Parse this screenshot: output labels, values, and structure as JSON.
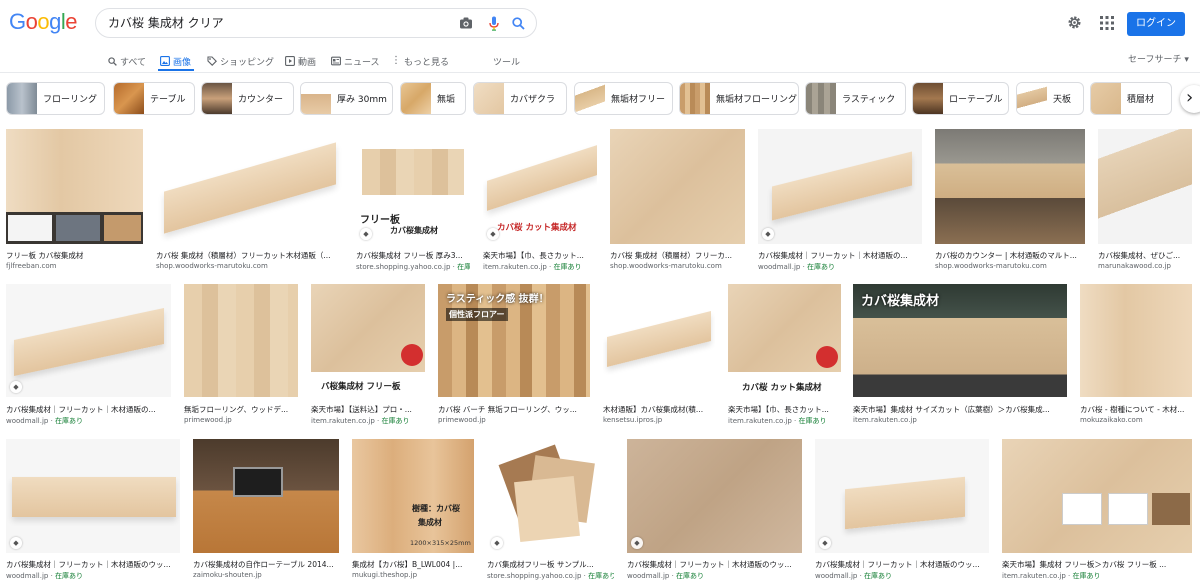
{
  "logo": "Google",
  "search": {
    "query": "カバ桜 集成材 クリア"
  },
  "header": {
    "login_label": "ログイン"
  },
  "nav": {
    "tabs": [
      {
        "label": "すべて",
        "icon": "search-icon"
      },
      {
        "label": "画像",
        "icon": "image-icon"
      },
      {
        "label": "ショッピング",
        "icon": "tag-icon"
      },
      {
        "label": "動画",
        "icon": "video-icon"
      },
      {
        "label": "ニュース",
        "icon": "news-icon"
      },
      {
        "label": "もっと見る",
        "icon": "more-icon"
      },
      {
        "label": "ツール",
        "icon": ""
      }
    ],
    "safe_search": "セーフサーチ ▾"
  },
  "chips": [
    "フローリング",
    "テーブル",
    "カウンター",
    "厚み 30mm",
    "無垢",
    "カバザクラ",
    "無垢材フリー",
    "無垢材フローリング",
    "ラスティック",
    "ローテーブル",
    "天板",
    "積層材"
  ],
  "results": [
    {
      "title": "フリー板 カバ桜集成材",
      "source": "fjlfreeban.com",
      "stock": ""
    },
    {
      "title": "カバ桜 集成材（積層材）フリーカット木材通販（...",
      "source": "shop.woodworks-marutoku.com",
      "stock": ""
    },
    {
      "title": "カバ桜集成材 フリー板 厚み3...",
      "source": "store.shopping.yahoo.co.jp",
      "stock": "在庫あり"
    },
    {
      "title": "楽天市場】【巾、長さカット...",
      "source": "item.rakuten.co.jp",
      "stock": "在庫あり"
    },
    {
      "title": "カバ桜 集成材（積層材）フリーカ...",
      "source": "shop.woodworks-marutoku.com",
      "stock": ""
    },
    {
      "title": "カバ桜集成材｜フリーカット｜木材通販の...",
      "source": "woodmall.jp",
      "stock": "在庫あり"
    },
    {
      "title": "カバ桜のカウンター | 木材通販のマルト...",
      "source": "shop.woodworks-marutoku.com",
      "stock": ""
    },
    {
      "title": "カバ桜集成材、ぜひご...",
      "source": "marunakawood.co.jp",
      "stock": ""
    },
    {
      "title": "カバ桜集成材｜フリーカット｜木材通販の...",
      "source": "woodmall.jp",
      "stock": "在庫あり"
    },
    {
      "title": "無垢フローリング、ウッドデ...",
      "source": "primewood.jp",
      "stock": ""
    },
    {
      "title": "楽天市場】【送料込】プロ・...",
      "source": "item.rakuten.co.jp",
      "stock": "在庫あり"
    },
    {
      "title": "カバ桜 バーチ 無垢フローリング、ウッ...",
      "source": "primewood.jp",
      "stock": ""
    },
    {
      "title": "木材通販】カバ桜集成材(積...",
      "source": "kensetsu.ipros.jp",
      "stock": ""
    },
    {
      "title": "楽天市場】【巾、長さカット...",
      "source": "item.rakuten.co.jp",
      "stock": "在庫あり"
    },
    {
      "title": "楽天市場】集成材 サイズカット（広葉樹）＞カバ桜集成...",
      "source": "item.rakuten.co.jp",
      "stock": ""
    },
    {
      "title": "カバ桜 - 樹種について - 木材...",
      "source": "mokuzaikako.com",
      "stock": ""
    },
    {
      "title": "カバ桜集成材｜フリーカット｜木材通販のウッ...",
      "source": "woodmall.jp",
      "stock": "在庫あり"
    },
    {
      "title": "カバ桜集成材の自作ローテーブル 2014...",
      "source": "zaimoku-shouten.jp",
      "stock": ""
    },
    {
      "title": "集成材【カバ桜】B_LWL004 |...",
      "source": "mukugi.theshop.jp",
      "stock": ""
    },
    {
      "title": "カバ集成材フリー板 サンプル...",
      "source": "store.shopping.yahoo.co.jp",
      "stock": "在庫あり"
    },
    {
      "title": "カバ桜集成材｜フリーカット｜木材通販のウッ...",
      "source": "woodmall.jp",
      "stock": "在庫あり"
    },
    {
      "title": "カバ桜集成材｜フリーカット｜木材通販のウッ...",
      "source": "woodmall.jp",
      "stock": "在庫あり"
    },
    {
      "title": "楽天市場】集成材 フリー板＞カバ桜 フリー板 ...",
      "source": "item.rakuten.co.jp",
      "stock": "在庫あり"
    }
  ],
  "overlays": {
    "r3_text": "フリー板",
    "r3_sub": "カバ桜集成材",
    "r4_text": "カバ桜 カット集成材",
    "r11_text": "バ桜集成材 フリー板",
    "r12_text": "ラスティック感 抜群！",
    "r12_sub": "個性派フロアー",
    "r14_text": "カバ桜 カット集成材",
    "r15_text": "カバ桜集成材",
    "r19_text": "樹種：カバ桜",
    "r19_sub": "集成材",
    "r19_dim": "1200×315×25mm"
  }
}
